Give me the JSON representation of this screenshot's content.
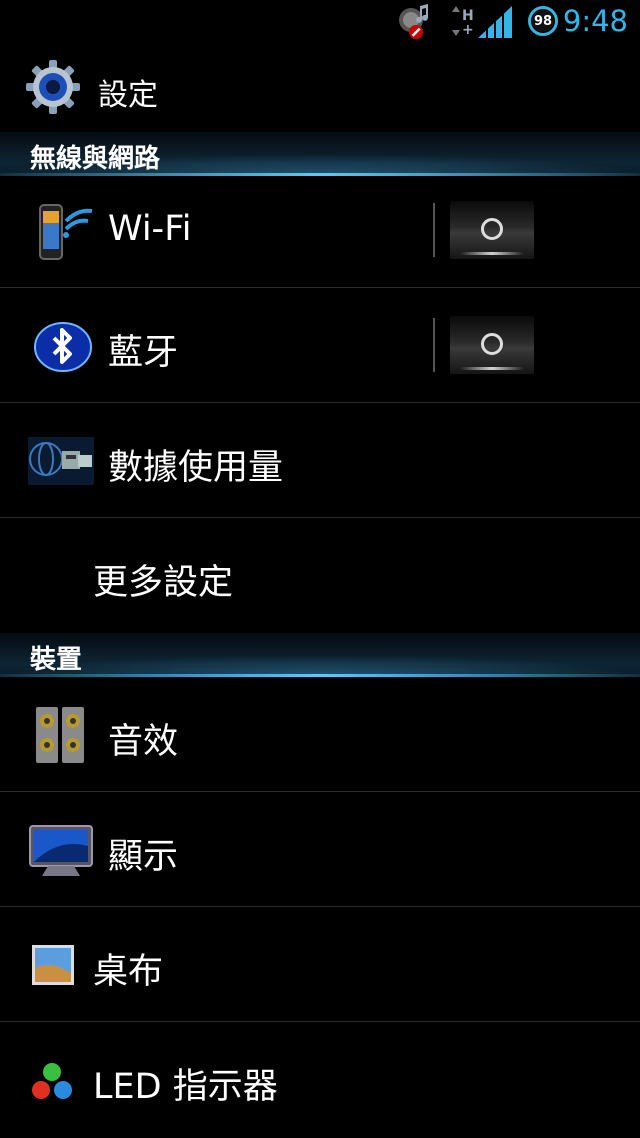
{
  "status_bar": {
    "time": "9:48",
    "battery_level": "98",
    "icons": [
      "notification-audio-icon",
      "hplus-data-icon",
      "signal-strength-icon",
      "battery-icon"
    ],
    "accent_color": "#33b5e5"
  },
  "action_bar": {
    "title": "設定",
    "icon": "settings-gear-icon"
  },
  "sections": {
    "wireless": {
      "header": "無線與網路"
    },
    "device": {
      "header": "裝置"
    }
  },
  "items": {
    "wifi": {
      "label": "Wi-Fi",
      "icon": "phone-wifi-icon",
      "toggle": "off"
    },
    "bluetooth": {
      "label": "藍牙",
      "icon": "bluetooth-icon",
      "toggle": "off"
    },
    "data_usage": {
      "label": "數據使用量",
      "icon": "network-port-icon"
    },
    "more": {
      "label": "更多設定"
    },
    "sound": {
      "label": "音效",
      "icon": "speakers-icon"
    },
    "display": {
      "label": "顯示",
      "icon": "monitor-icon"
    },
    "wallpaper": {
      "label": "桌布",
      "icon": "picture-icon"
    },
    "led": {
      "label": "LED 指示器",
      "icon": "led-dots-icon"
    }
  }
}
